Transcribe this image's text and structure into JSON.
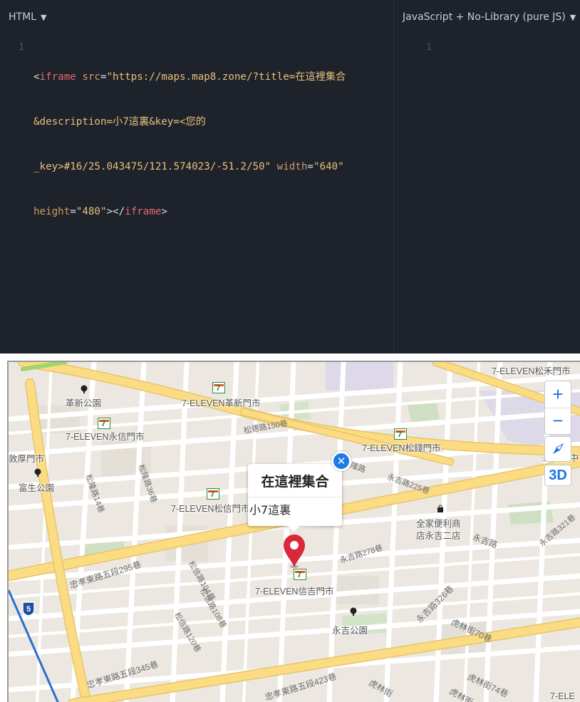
{
  "html_pane": {
    "header_label": "HTML",
    "line_number": "1",
    "code_lines": [
      {
        "lt": "<",
        "tag": "iframe",
        "sp": " ",
        "attr1": "src",
        "eq1": "=",
        "str1": "\"https://maps.map8.zone/?title=在這裡集合"
      },
      {
        "str1b": "&description=小7這裏&key=<您的"
      },
      {
        "str1c": "_key>#16/25.043475/121.574023/-51.2/50\"",
        "sp": " ",
        "attr2": "width",
        "eq2": "=",
        "str2": "\"640\""
      },
      {
        "attr3": "height",
        "eq3": "=",
        "str3": "\"480\"",
        "gt": ">",
        "lt2": "</",
        "tag2": "iframe",
        "gt2": ">"
      }
    ]
  },
  "js_pane": {
    "header_label": "JavaScript + No-Library (pure JS)",
    "line_number": "1"
  },
  "map": {
    "popup": {
      "title": "在這裡集合",
      "description": "小7這裏"
    },
    "controls": {
      "zoom_in": "+",
      "zoom_out": "−",
      "mode_3d": "3D"
    },
    "route_shield": "5",
    "places": [
      {
        "id": "geshin-park",
        "label": "革新公園"
      },
      {
        "id": "711-geshin",
        "label": "7-ELEVEN革新門市"
      },
      {
        "id": "711-yongxin",
        "label": "7-ELEVEN永信門市"
      },
      {
        "id": "711-songhe",
        "label": "7-ELEVEN松禾門市"
      },
      {
        "id": "711-songqian",
        "label": "7-ELEVEN松錢門市"
      },
      {
        "id": "yongji-main",
        "label": "永吉國中"
      },
      {
        "id": "houmen",
        "label": "敦厚門市"
      },
      {
        "id": "fusheng-park",
        "label": "富生公園"
      },
      {
        "id": "711-songxin",
        "label": "7-ELEVEN松信門市"
      },
      {
        "id": "family-mart",
        "label": "全家便利商"
      },
      {
        "id": "family-mart-2",
        "label": "店永吉二店"
      },
      {
        "id": "711-xinji",
        "label": "7-ELEVEN信吉門市"
      },
      {
        "id": "yongji-park",
        "label": "永吉公園"
      },
      {
        "id": "7ele-edge",
        "label": "7-ELE"
      }
    ],
    "streets": [
      {
        "label": "忠孝東路五段295巷"
      },
      {
        "label": "忠孝東路五段345巷"
      },
      {
        "label": "忠孝東路五段423巷"
      },
      {
        "label": "永吉路278巷"
      },
      {
        "label": "永吉路326巷"
      },
      {
        "label": "永吉路"
      },
      {
        "label": "永吉路225巷"
      },
      {
        "label": "永吉路321巷"
      },
      {
        "label": "虎林街70巷"
      },
      {
        "label": "虎林街74巷"
      },
      {
        "label": "虎林街"
      },
      {
        "label": "虎林街"
      },
      {
        "label": "松隆路"
      },
      {
        "label": "松信路104巷"
      },
      {
        "label": "松信路108巷"
      },
      {
        "label": "松信路120巷"
      },
      {
        "label": "松隆路14巷"
      },
      {
        "label": "松隆路36巷"
      },
      {
        "label": "松德路150巷"
      }
    ]
  }
}
